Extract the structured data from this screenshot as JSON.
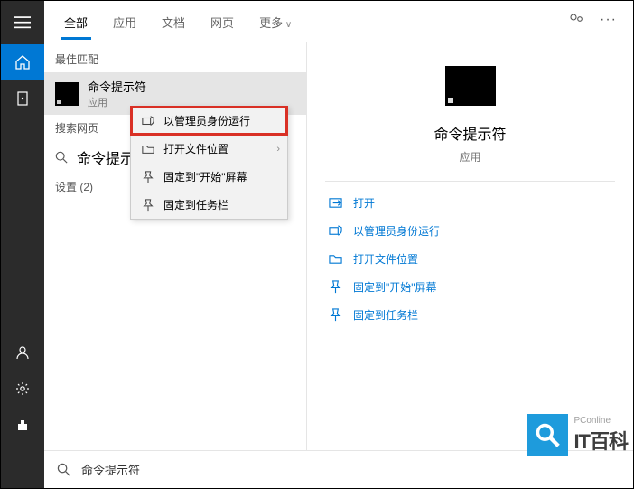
{
  "tabs": {
    "all": "全部",
    "apps": "应用",
    "docs": "文档",
    "web": "网页",
    "more": "更多"
  },
  "sections": {
    "best_match": "最佳匹配",
    "search_web": "搜索网页",
    "settings": "设置 (2)"
  },
  "result": {
    "title": "命令提示符",
    "sub": "应用"
  },
  "search_web_item": "命令提示符",
  "context_menu": {
    "run_admin": "以管理员身份运行",
    "open_location": "打开文件位置",
    "pin_start": "固定到\"开始\"屏幕",
    "pin_taskbar": "固定到任务栏"
  },
  "preview": {
    "title": "命令提示符",
    "sub": "应用"
  },
  "actions": {
    "open": "打开",
    "run_admin": "以管理员身份运行",
    "open_location": "打开文件位置",
    "pin_start": "固定到\"开始\"屏幕",
    "pin_taskbar": "固定到任务栏"
  },
  "searchbar": {
    "query": "命令提示符"
  },
  "watermark": {
    "small": "PConline",
    "big": "IT百科"
  }
}
